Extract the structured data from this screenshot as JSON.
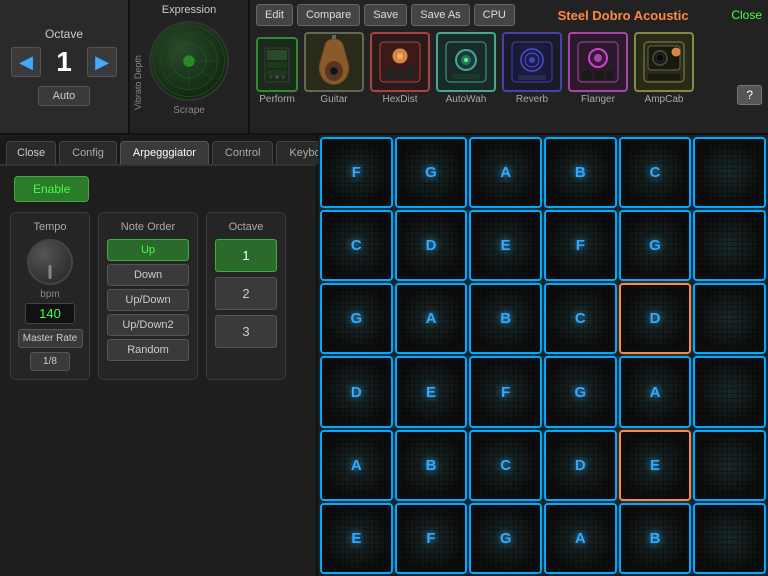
{
  "topbar": {
    "octave_label": "Octave",
    "octave_value": "1",
    "auto_label": "Auto",
    "expression_title": "Expression",
    "vibrato_label": "Vibrato Depth",
    "scrape_label": "Scrape",
    "buttons": {
      "edit": "Edit",
      "compare": "Compare",
      "save": "Save",
      "save_as": "Save As",
      "cpu": "CPU"
    },
    "instrument_name": "Steel Dobro Acoustic",
    "close_label": "Close",
    "help_label": "?",
    "fx": [
      {
        "id": "perform",
        "label": "Perform"
      },
      {
        "id": "guitar",
        "label": "Guitar"
      },
      {
        "id": "hexdist",
        "label": "HexDist"
      },
      {
        "id": "autowah",
        "label": "AutoWah"
      },
      {
        "id": "reverb",
        "label": "Reverb"
      },
      {
        "id": "flanger",
        "label": "Flanger"
      },
      {
        "id": "ampcab",
        "label": "AmpCab"
      }
    ]
  },
  "panel": {
    "tabs": [
      "Close",
      "Config",
      "Arpegggiator",
      "Control",
      "Keyboard"
    ],
    "active_tab": "Arpegggiator",
    "enable_label": "Enable",
    "tempo": {
      "title": "Tempo",
      "bpm_label": "bpm",
      "bpm_value": "140",
      "master_rate": "Master Rate",
      "eighth": "1/8"
    },
    "note_order": {
      "title": "Note Order",
      "options": [
        "Up",
        "Down",
        "Up/Down",
        "Up/Down2",
        "Random"
      ],
      "active": "Up"
    },
    "octave": {
      "title": "Octave",
      "options": [
        "1",
        "2",
        "3"
      ],
      "active": "1"
    }
  },
  "grid": {
    "rows": [
      [
        "F",
        "G",
        "A",
        "B",
        "C",
        ""
      ],
      [
        "C",
        "D",
        "E",
        "F",
        "G",
        ""
      ],
      [
        "G",
        "A",
        "B",
        "C",
        "D",
        ""
      ],
      [
        "D",
        "E",
        "F",
        "G",
        "A",
        ""
      ],
      [
        "A",
        "B",
        "C",
        "D",
        "E",
        ""
      ],
      [
        "E",
        "F",
        "G",
        "A",
        "B",
        ""
      ]
    ],
    "cyan_cells": [
      [
        0,
        0
      ],
      [
        0,
        1
      ],
      [
        0,
        2
      ],
      [
        0,
        3
      ],
      [
        1,
        0
      ],
      [
        1,
        1
      ],
      [
        1,
        2
      ],
      [
        1,
        3
      ],
      [
        1,
        4
      ],
      [
        2,
        0
      ],
      [
        2,
        1
      ],
      [
        2,
        2
      ],
      [
        2,
        3
      ],
      [
        3,
        0
      ],
      [
        3,
        1
      ],
      [
        3,
        2
      ],
      [
        3,
        3
      ],
      [
        3,
        4
      ],
      [
        4,
        0
      ],
      [
        4,
        1
      ],
      [
        4,
        2
      ],
      [
        4,
        3
      ],
      [
        5,
        0
      ],
      [
        5,
        1
      ],
      [
        5,
        2
      ],
      [
        5,
        3
      ],
      [
        5,
        4
      ]
    ],
    "orange_cells": [
      [
        2,
        4
      ],
      [
        4,
        4
      ]
    ]
  }
}
